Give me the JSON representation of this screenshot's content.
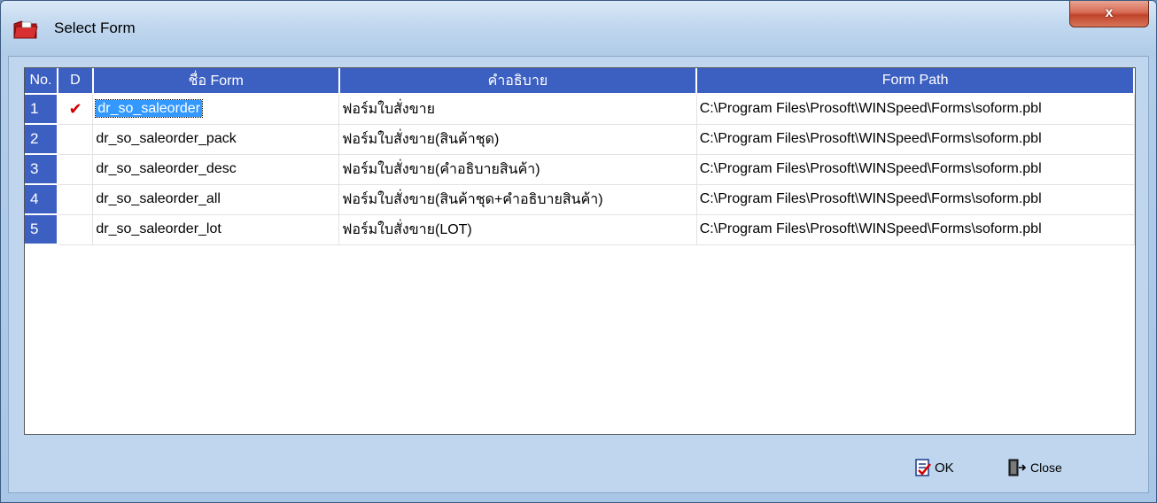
{
  "window": {
    "title": "Select Form",
    "close_glyph": "x"
  },
  "grid": {
    "columns": {
      "no": "No.",
      "d": "D",
      "name": "ชื่อ Form",
      "desc": "คำอธิบาย",
      "path": "Form Path"
    },
    "rows": [
      {
        "no": "1",
        "d": "✔",
        "name": "dr_so_saleorder",
        "desc": "ฟอร์มใบสั่งขาย",
        "path": "C:\\Program Files\\Prosoft\\WINSpeed\\Forms\\soform.pbl"
      },
      {
        "no": "2",
        "d": "",
        "name": "dr_so_saleorder_pack",
        "desc": "ฟอร์มใบสั่งขาย(สินค้าชุด)",
        "path": "C:\\Program Files\\Prosoft\\WINSpeed\\Forms\\soform.pbl"
      },
      {
        "no": "3",
        "d": "",
        "name": "dr_so_saleorder_desc",
        "desc": "ฟอร์มใบสั่งขาย(คำอธิบายสินค้า)",
        "path": "C:\\Program Files\\Prosoft\\WINSpeed\\Forms\\soform.pbl"
      },
      {
        "no": "4",
        "d": "",
        "name": "dr_so_saleorder_all",
        "desc": "ฟอร์มใบสั่งขาย(สินค้าชุด+คำอธิบายสินค้า)",
        "path": "C:\\Program Files\\Prosoft\\WINSpeed\\Forms\\soform.pbl"
      },
      {
        "no": "5",
        "d": "",
        "name": "dr_so_saleorder_lot",
        "desc": "ฟอร์มใบสั่งขาย(LOT)",
        "path": "C:\\Program Files\\Prosoft\\WINSpeed\\Forms\\soform.pbl"
      }
    ]
  },
  "footer": {
    "ok_label": "OK",
    "close_label": "Close"
  },
  "icons": {
    "app": "red-folder-icon",
    "ok": "ok-checklist-icon",
    "close": "exit-door-icon",
    "check": "check-mark-icon"
  },
  "colors": {
    "header_bg": "#3c5fc2",
    "check_mark": "#d40000",
    "selection": "#3399ff",
    "close_button": "#c0432a"
  }
}
